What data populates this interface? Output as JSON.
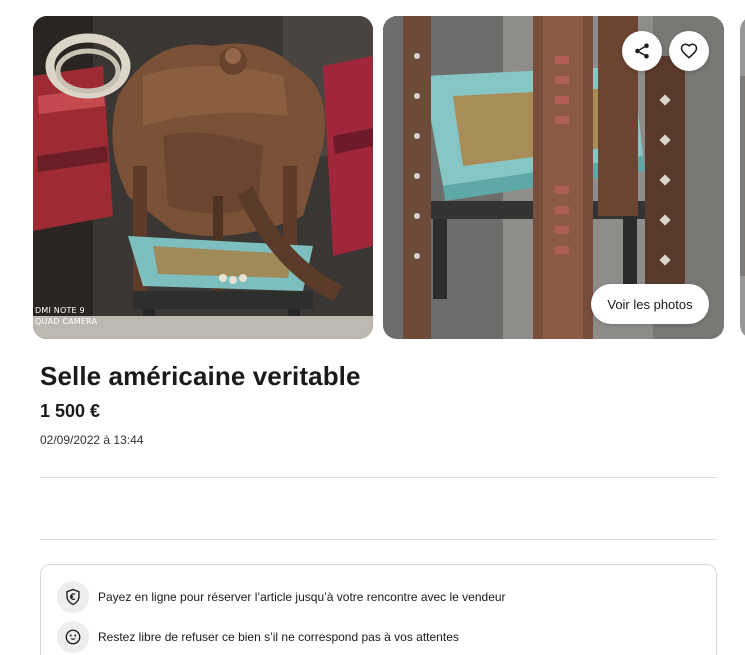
{
  "gallery": {
    "main_watermark_line1": "DMI NOTE 9",
    "main_watermark_line2": "QUAD CAMERA",
    "see_photos_label": "Voir les photos",
    "share_icon": "share-icon",
    "favorite_icon": "heart-icon"
  },
  "listing": {
    "title": "Selle américaine veritable",
    "price": "1 500 €",
    "date": "02/09/2022 à 13:44"
  },
  "protection": {
    "items": [
      {
        "icon": "euro-shield-icon",
        "text": "Payez en ligne pour réserver l’article jusqu’à votre rencontre avec le vendeur"
      },
      {
        "icon": "smile-icon",
        "text": "Restez libre de refuser ce bien s’il ne correspond pas à vos attentes"
      }
    ]
  },
  "colors": {
    "text": "#1a1a1a",
    "divider": "#dcdcdc",
    "icon_bg": "#eeeeee"
  }
}
